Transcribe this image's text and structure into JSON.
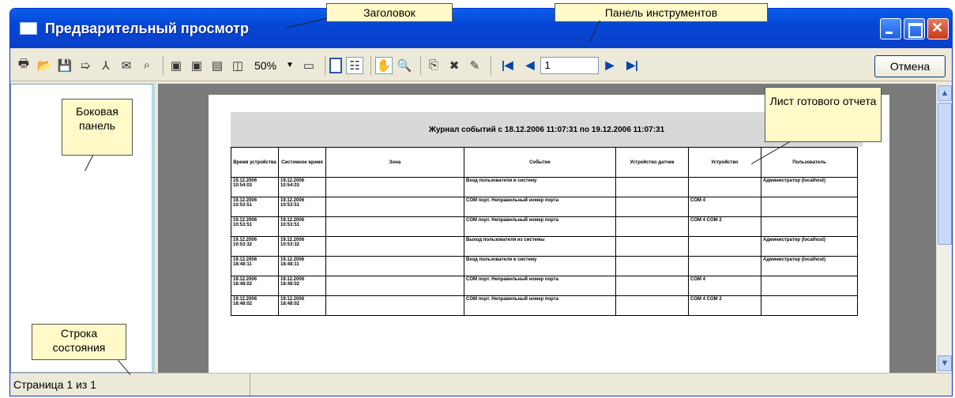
{
  "window": {
    "title": "Предварительный просмотр"
  },
  "toolbar": {
    "zoom_value": "50%",
    "page_value": "1",
    "cancel_label": "Отмена"
  },
  "report": {
    "heading": "Журнал событий с 18.12.2006 11:07:31 по 19.12.2006 11:07:31",
    "columns": [
      "Время устройства",
      "Системное время",
      "Зона",
      "Событие",
      "Устройство датчик",
      "Устройство",
      "Пользователь"
    ],
    "rows": [
      [
        "19.12.2006 10:54:03",
        "19.12.2006 10:54:03",
        "",
        "Вход пользователя в систему",
        "",
        "",
        "Администратор (localhost)"
      ],
      [
        "19.12.2006 10:53:51",
        "19.12.2006 10:53:51",
        "",
        "COM порт. Неправильный номер порта",
        "",
        "COM 4",
        ""
      ],
      [
        "19.12.2006 10:53:51",
        "19.12.2006 10:53:51",
        "",
        "COM порт. Неправильный номер порта",
        "",
        "COM 4 COM 2",
        ""
      ],
      [
        "19.12.2006 10:53:32",
        "19.12.2006 10:53:32",
        "",
        "Выход пользователя из системы",
        "",
        "",
        "Администратор (localhost)"
      ],
      [
        "19.12.2006 18:48:11",
        "19.12.2006 18:48:11",
        "",
        "Вход пользователя в систему",
        "",
        "",
        "Администратор (localhost)"
      ],
      [
        "19.12.2006 18:48:02",
        "19.12.2006 18:48:02",
        "",
        "COM порт. Неправильный номер порта",
        "",
        "COM 4",
        ""
      ],
      [
        "19.12.2006 18:48:02",
        "19.12.2006 18:48:02",
        "",
        "COM порт. Неправильный номер порта",
        "",
        "COM 4 COM 2",
        ""
      ]
    ]
  },
  "status": {
    "page_text": "Страница 1 из 1"
  },
  "callouts": {
    "title": "Заголовок",
    "toolbar": "Панель инструментов",
    "sidebar": "Боковая панель",
    "sheet": "Лист готового отчета",
    "statusbar": "Строка состояния"
  }
}
